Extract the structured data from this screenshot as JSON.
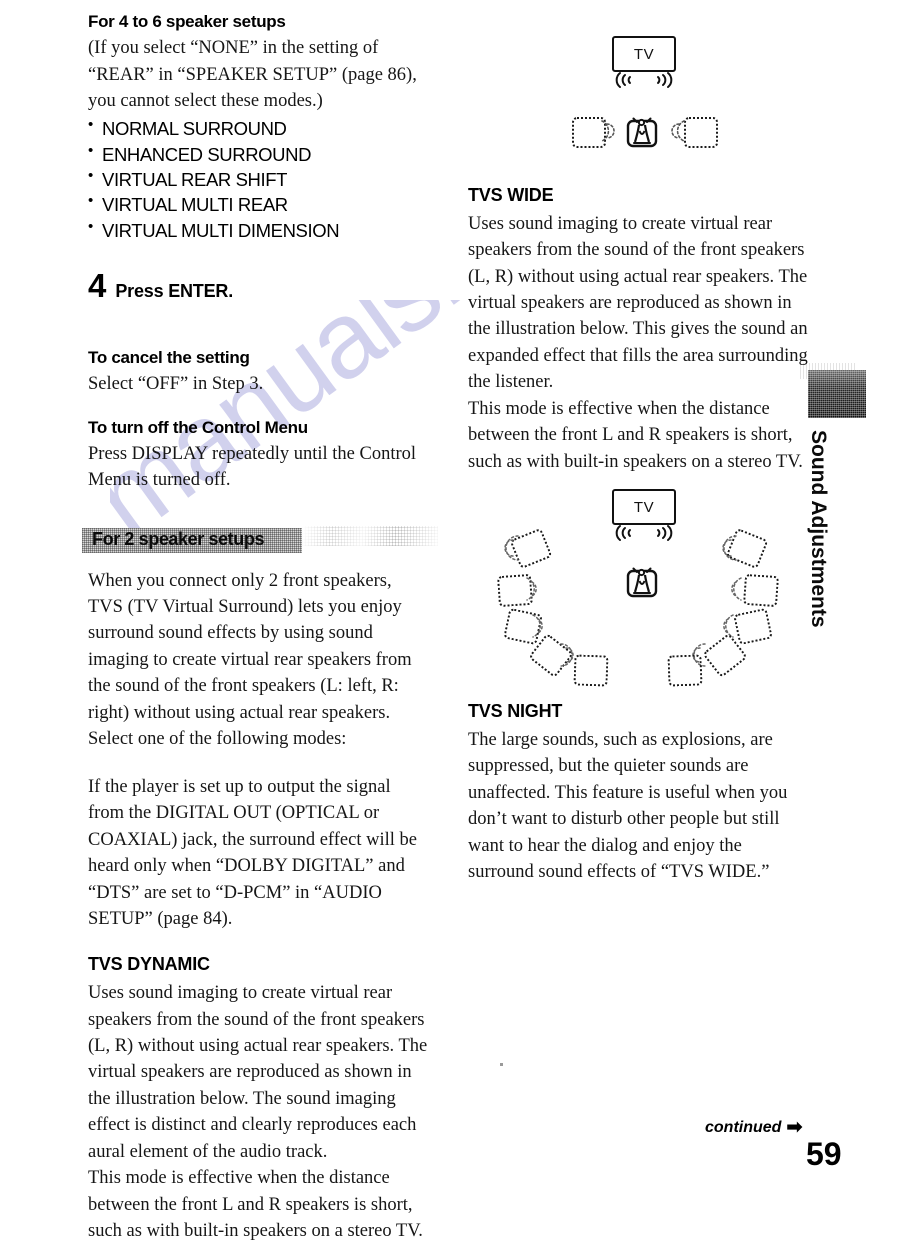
{
  "page": {
    "number": "59",
    "continued_label": "continued",
    "continued_arrow": "➡",
    "side_tab_label": "Sound Adjustments"
  },
  "left_column": {
    "section_4to6": {
      "heading": "For 4 to 6 speaker setups",
      "intro": "(If you select “NONE” in the setting of “REAR” in “SPEAKER SETUP” (page 86), you cannot select these modes.)",
      "modes": [
        "NORMAL SURROUND",
        "ENHANCED SURROUND",
        "VIRTUAL REAR SHIFT",
        "VIRTUAL MULTI REAR",
        "VIRTUAL MULTI DIMENSION"
      ]
    },
    "step": {
      "number": "4",
      "text": "Press ENTER."
    },
    "cancel": {
      "heading": "To cancel the setting",
      "body": "Select “OFF” in Step 3."
    },
    "turn_off": {
      "heading": "To turn off the Control Menu",
      "body": "Press DISPLAY repeatedly until the Control Menu is turned off."
    },
    "section_2spk": {
      "heading": "For 2 speaker setups",
      "para1": "When you connect only 2 front speakers, TVS (TV Virtual Surround) lets you enjoy surround sound effects by using sound imaging to create virtual rear speakers from the sound of the front speakers (L: left, R: right) without using actual rear speakers. Select one of the following modes:",
      "para2": "If the player is set up to output the signal from the DIGITAL OUT (OPTICAL or COAXIAL) jack, the surround effect will be heard only when “DOLBY DIGITAL” and “DTS” are set to “D-PCM” in “AUDIO SETUP” (page 84)."
    },
    "tvs_dynamic": {
      "heading": "TVS DYNAMIC",
      "para1": "Uses sound imaging to create virtual rear speakers from the sound of the front speakers (L, R) without using actual rear speakers. The virtual speakers are reproduced as shown in the illustration below. The sound imaging effect is distinct and clearly reproduces each aural element of the audio track.",
      "para2": "This mode is effective when the distance between the front L and R speakers is short, such as with built-in speakers on a stereo TV."
    }
  },
  "right_column": {
    "diagram_dynamic": {
      "tv_label": "TV",
      "virtual_speaker_count": 2
    },
    "tvs_wide": {
      "heading": "TVS WIDE",
      "para1": "Uses sound imaging to create virtual rear speakers from the sound of the front speakers (L, R) without using actual rear speakers. The virtual speakers are reproduced as shown in the illustration below. This gives the sound an expanded effect that fills the area surrounding the listener.",
      "para2": "This mode is effective when the distance between the front L and R speakers is short, such as with built-in speakers on a stereo TV."
    },
    "diagram_wide": {
      "tv_label": "TV",
      "virtual_speaker_count": 10
    },
    "tvs_night": {
      "heading": "TVS NIGHT",
      "para1": "The large sounds, such as explosions, are suppressed, but the quieter sounds are unaffected. This feature is useful when you don’t want to disturb other people but still want to hear the dialog and enjoy the surround sound effects of “TVS WIDE.”"
    }
  },
  "watermark": {
    "text": "manualshive.com",
    "color": "#c9c9ea"
  }
}
